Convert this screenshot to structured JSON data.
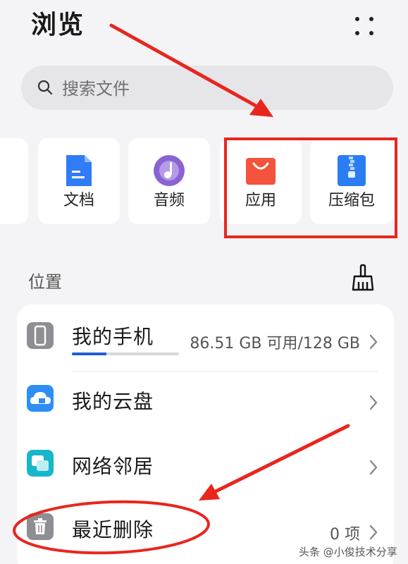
{
  "header": {
    "title": "浏览"
  },
  "search": {
    "placeholder": "搜索文件"
  },
  "categories": [
    {
      "label": "文档",
      "icon": "document-icon"
    },
    {
      "label": "音频",
      "icon": "audio-icon"
    },
    {
      "label": "应用",
      "icon": "app-bag-icon"
    },
    {
      "label": "压缩包",
      "icon": "zip-icon"
    }
  ],
  "location": {
    "title": "位置",
    "rows": [
      {
        "label": "我的手机",
        "detail": "86.51 GB 可用/128 GB",
        "icon": "phone-icon",
        "storage_used_fraction": 0.32
      },
      {
        "label": "我的云盘",
        "detail": "",
        "icon": "cloud-drive-icon"
      },
      {
        "label": "网络邻居",
        "detail": "",
        "icon": "network-neighbor-icon"
      },
      {
        "label": "最近删除",
        "detail": "0 项",
        "icon": "trash-icon"
      }
    ]
  },
  "watermark": "头条 @小俊技术分享",
  "colors": {
    "accent": "#1f5fd6",
    "annotation": "#e8261e",
    "doc_blue": "#2f7cf6",
    "audio_purple": "#8a63d2",
    "app_red": "#f4533c",
    "zip_blue": "#2b7df4"
  }
}
